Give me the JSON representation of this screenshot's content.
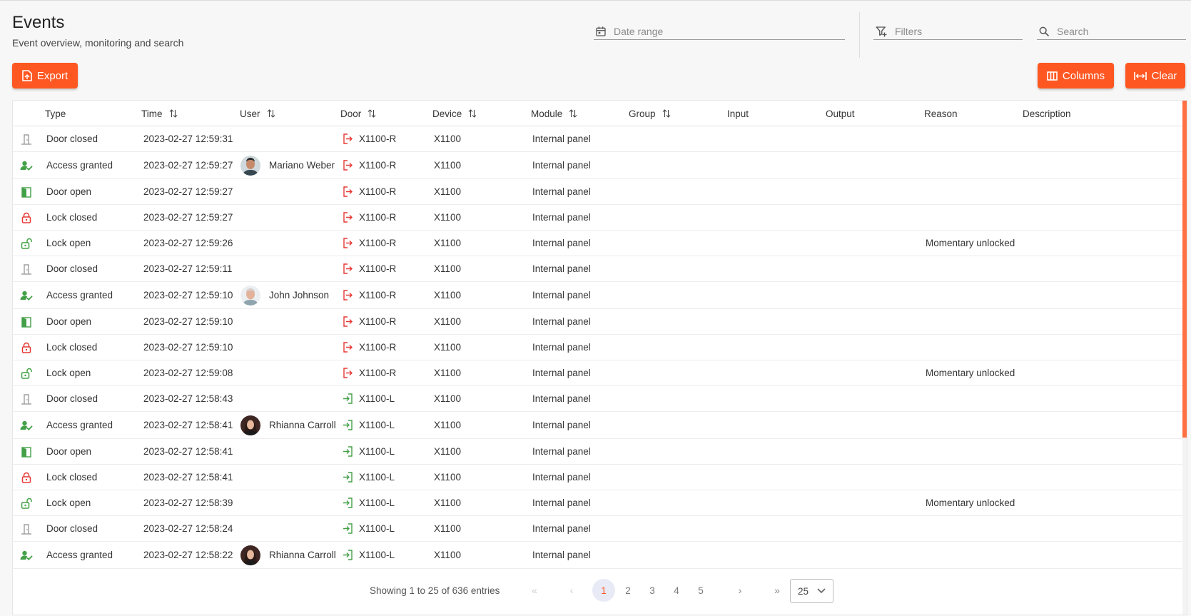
{
  "page": {
    "title": "Events",
    "subtitle": "Event overview, monitoring and search"
  },
  "toolbar": {
    "date_range_placeholder": "Date range",
    "filters_placeholder": "Filters",
    "search_placeholder": "Search",
    "export_label": "Export",
    "columns_label": "Columns",
    "clear_label": "Clear"
  },
  "colors": {
    "accent": "#ff5722",
    "granted_green": "#43a047",
    "lock_red": "#e53935",
    "neutral_icon": "#9e9e9e"
  },
  "table": {
    "columns": [
      {
        "label": "Type",
        "sortable": false
      },
      {
        "label": "Time",
        "sortable": true
      },
      {
        "label": "User",
        "sortable": true
      },
      {
        "label": "Door",
        "sortable": true
      },
      {
        "label": "Device",
        "sortable": true
      },
      {
        "label": "Module",
        "sortable": true
      },
      {
        "label": "Group",
        "sortable": true
      },
      {
        "label": "Input",
        "sortable": false
      },
      {
        "label": "Output",
        "sortable": false
      },
      {
        "label": "Reason",
        "sortable": false
      },
      {
        "label": "Description",
        "sortable": false
      }
    ],
    "rows": [
      {
        "icon": "door-closed-icon",
        "type": "Door closed",
        "time": "2023-02-27 12:59:31",
        "user": "",
        "avatar": "",
        "door_icon": "door-exit-icon",
        "door": "X1100-R",
        "device": "X1100",
        "module": "Internal panel",
        "group": "",
        "input": "",
        "output": "",
        "reason": "",
        "description": ""
      },
      {
        "icon": "access-granted-icon",
        "type": "Access granted",
        "time": "2023-02-27 12:59:27",
        "user": "Mariano Weber",
        "avatar": "male-dark",
        "door_icon": "door-exit-icon",
        "door": "X1100-R",
        "device": "X1100",
        "module": "Internal panel",
        "group": "",
        "input": "",
        "output": "",
        "reason": "",
        "description": ""
      },
      {
        "icon": "door-open-icon",
        "type": "Door open",
        "time": "2023-02-27 12:59:27",
        "user": "",
        "avatar": "",
        "door_icon": "door-exit-icon",
        "door": "X1100-R",
        "device": "X1100",
        "module": "Internal panel",
        "group": "",
        "input": "",
        "output": "",
        "reason": "",
        "description": ""
      },
      {
        "icon": "lock-closed-icon",
        "type": "Lock closed",
        "time": "2023-02-27 12:59:27",
        "user": "",
        "avatar": "",
        "door_icon": "door-exit-icon",
        "door": "X1100-R",
        "device": "X1100",
        "module": "Internal panel",
        "group": "",
        "input": "",
        "output": "",
        "reason": "",
        "description": ""
      },
      {
        "icon": "lock-open-icon",
        "type": "Lock open",
        "time": "2023-02-27 12:59:26",
        "user": "",
        "avatar": "",
        "door_icon": "door-exit-icon",
        "door": "X1100-R",
        "device": "X1100",
        "module": "Internal panel",
        "group": "",
        "input": "",
        "output": "",
        "reason": "Momentary unlocked",
        "description": ""
      },
      {
        "icon": "door-closed-icon",
        "type": "Door closed",
        "time": "2023-02-27 12:59:11",
        "user": "",
        "avatar": "",
        "door_icon": "door-exit-icon",
        "door": "X1100-R",
        "device": "X1100",
        "module": "Internal panel",
        "group": "",
        "input": "",
        "output": "",
        "reason": "",
        "description": ""
      },
      {
        "icon": "access-granted-icon",
        "type": "Access granted",
        "time": "2023-02-27 12:59:10",
        "user": "John Johnson",
        "avatar": "male-light",
        "door_icon": "door-exit-icon",
        "door": "X1100-R",
        "device": "X1100",
        "module": "Internal panel",
        "group": "",
        "input": "",
        "output": "",
        "reason": "",
        "description": ""
      },
      {
        "icon": "door-open-icon",
        "type": "Door open",
        "time": "2023-02-27 12:59:10",
        "user": "",
        "avatar": "",
        "door_icon": "door-exit-icon",
        "door": "X1100-R",
        "device": "X1100",
        "module": "Internal panel",
        "group": "",
        "input": "",
        "output": "",
        "reason": "",
        "description": ""
      },
      {
        "icon": "lock-closed-icon",
        "type": "Lock closed",
        "time": "2023-02-27 12:59:10",
        "user": "",
        "avatar": "",
        "door_icon": "door-exit-icon",
        "door": "X1100-R",
        "device": "X1100",
        "module": "Internal panel",
        "group": "",
        "input": "",
        "output": "",
        "reason": "",
        "description": ""
      },
      {
        "icon": "lock-open-icon",
        "type": "Lock open",
        "time": "2023-02-27 12:59:08",
        "user": "",
        "avatar": "",
        "door_icon": "door-exit-icon",
        "door": "X1100-R",
        "device": "X1100",
        "module": "Internal panel",
        "group": "",
        "input": "",
        "output": "",
        "reason": "Momentary unlocked",
        "description": ""
      },
      {
        "icon": "door-closed-icon",
        "type": "Door closed",
        "time": "2023-02-27 12:58:43",
        "user": "",
        "avatar": "",
        "door_icon": "door-entry-icon",
        "door": "X1100-L",
        "device": "X1100",
        "module": "Internal panel",
        "group": "",
        "input": "",
        "output": "",
        "reason": "",
        "description": ""
      },
      {
        "icon": "access-granted-icon",
        "type": "Access granted",
        "time": "2023-02-27 12:58:41",
        "user": "Rhianna Carroll",
        "avatar": "female",
        "door_icon": "door-entry-icon",
        "door": "X1100-L",
        "device": "X1100",
        "module": "Internal panel",
        "group": "",
        "input": "",
        "output": "",
        "reason": "",
        "description": ""
      },
      {
        "icon": "door-open-icon",
        "type": "Door open",
        "time": "2023-02-27 12:58:41",
        "user": "",
        "avatar": "",
        "door_icon": "door-entry-icon",
        "door": "X1100-L",
        "device": "X1100",
        "module": "Internal panel",
        "group": "",
        "input": "",
        "output": "",
        "reason": "",
        "description": ""
      },
      {
        "icon": "lock-closed-icon",
        "type": "Lock closed",
        "time": "2023-02-27 12:58:41",
        "user": "",
        "avatar": "",
        "door_icon": "door-entry-icon",
        "door": "X1100-L",
        "device": "X1100",
        "module": "Internal panel",
        "group": "",
        "input": "",
        "output": "",
        "reason": "",
        "description": ""
      },
      {
        "icon": "lock-open-icon",
        "type": "Lock open",
        "time": "2023-02-27 12:58:39",
        "user": "",
        "avatar": "",
        "door_icon": "door-entry-icon",
        "door": "X1100-L",
        "device": "X1100",
        "module": "Internal panel",
        "group": "",
        "input": "",
        "output": "",
        "reason": "Momentary unlocked",
        "description": ""
      },
      {
        "icon": "door-closed-icon",
        "type": "Door closed",
        "time": "2023-02-27 12:58:24",
        "user": "",
        "avatar": "",
        "door_icon": "door-entry-icon",
        "door": "X1100-L",
        "device": "X1100",
        "module": "Internal panel",
        "group": "",
        "input": "",
        "output": "",
        "reason": "",
        "description": ""
      },
      {
        "icon": "access-granted-icon",
        "type": "Access granted",
        "time": "2023-02-27 12:58:22",
        "user": "Rhianna Carroll",
        "avatar": "female",
        "door_icon": "door-entry-icon",
        "door": "X1100-L",
        "device": "X1100",
        "module": "Internal panel",
        "group": "",
        "input": "",
        "output": "",
        "reason": "",
        "description": ""
      }
    ]
  },
  "pagination": {
    "summary": "Showing 1 to 25 of 636 entries",
    "first": "«",
    "prev": "‹",
    "pages": [
      "1",
      "2",
      "3",
      "4",
      "5"
    ],
    "current": "1",
    "next": "›",
    "last": "»",
    "page_size": "25"
  }
}
